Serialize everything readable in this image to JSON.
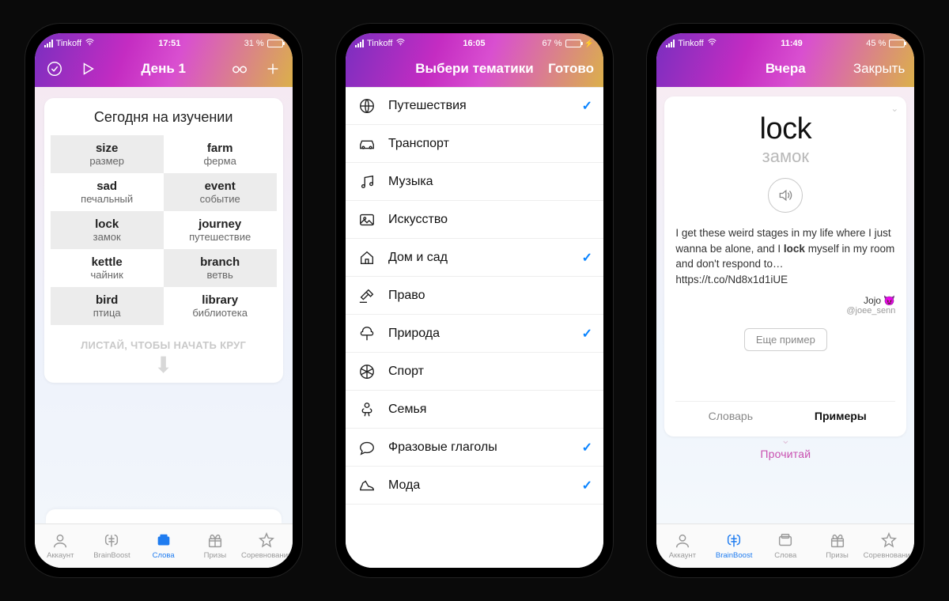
{
  "screen1": {
    "status": {
      "carrier": "Tinkoff",
      "time": "17:51",
      "battery_text": "31 %",
      "battery_pct": 31,
      "charging": false
    },
    "nav_title": "День 1",
    "card_title": "Сегодня на изучении",
    "words": [
      {
        "en": "size",
        "ru": "размер"
      },
      {
        "en": "farm",
        "ru": "ферма"
      },
      {
        "en": "sad",
        "ru": "печальный"
      },
      {
        "en": "event",
        "ru": "событие"
      },
      {
        "en": "lock",
        "ru": "замок"
      },
      {
        "en": "journey",
        "ru": "путешествие"
      },
      {
        "en": "kettle",
        "ru": "чайник"
      },
      {
        "en": "branch",
        "ru": "ветвь"
      },
      {
        "en": "bird",
        "ru": "птица"
      },
      {
        "en": "library",
        "ru": "библиотека"
      }
    ],
    "swipe_hint": "ЛИСТАЙ, ЧТОБЫ НАЧАТЬ КРУГ",
    "tabs": {
      "account": "Аккаунт",
      "brainboost": "BrainBoost",
      "words": "Слова",
      "prizes": "Призы",
      "competitions": "Соревнования"
    },
    "active_tab": "words"
  },
  "screen2": {
    "status": {
      "carrier": "Tinkoff",
      "time": "16:05",
      "battery_text": "67 %",
      "battery_pct": 67,
      "charging": true
    },
    "nav_title": "Выбери тематики",
    "done_label": "Готово",
    "topics": [
      {
        "icon": "globe",
        "label": "Путешествия",
        "checked": true
      },
      {
        "icon": "car",
        "label": "Транспорт",
        "checked": false
      },
      {
        "icon": "music",
        "label": "Музыка",
        "checked": false
      },
      {
        "icon": "image",
        "label": "Искусство",
        "checked": false
      },
      {
        "icon": "home",
        "label": "Дом и сад",
        "checked": true
      },
      {
        "icon": "gavel",
        "label": "Право",
        "checked": false
      },
      {
        "icon": "tree",
        "label": "Природа",
        "checked": true
      },
      {
        "icon": "ball",
        "label": "Спорт",
        "checked": false
      },
      {
        "icon": "baby",
        "label": "Семья",
        "checked": false
      },
      {
        "icon": "chat",
        "label": "Фразовые глаголы",
        "checked": true
      },
      {
        "icon": "shoe",
        "label": "Мода",
        "checked": true
      }
    ]
  },
  "screen3": {
    "status": {
      "carrier": "Tinkoff",
      "time": "11:49",
      "battery_text": "45 %",
      "battery_pct": 45,
      "charging": false
    },
    "nav_title": "Вчера",
    "close_label": "Закрыть",
    "word": "lock",
    "translation": "замок",
    "example_pre": "I get these weird stages in my life where I just wanna be alone, and I ",
    "example_bold": "lock",
    "example_post": " myself in my room and don't respond to… https://t.co/Nd8x1d1iUE",
    "author": "Jojo 😈",
    "handle": "@joee_senn",
    "more_example": "Еще пример",
    "tab_dict": "Словарь",
    "tab_examples": "Примеры",
    "read_hint": "Прочитай",
    "tabs": {
      "account": "Аккаунт",
      "brainboost": "BrainBoost",
      "words": "Слова",
      "prizes": "Призы",
      "competitions": "Соревнования"
    },
    "active_tab": "brainboost"
  }
}
